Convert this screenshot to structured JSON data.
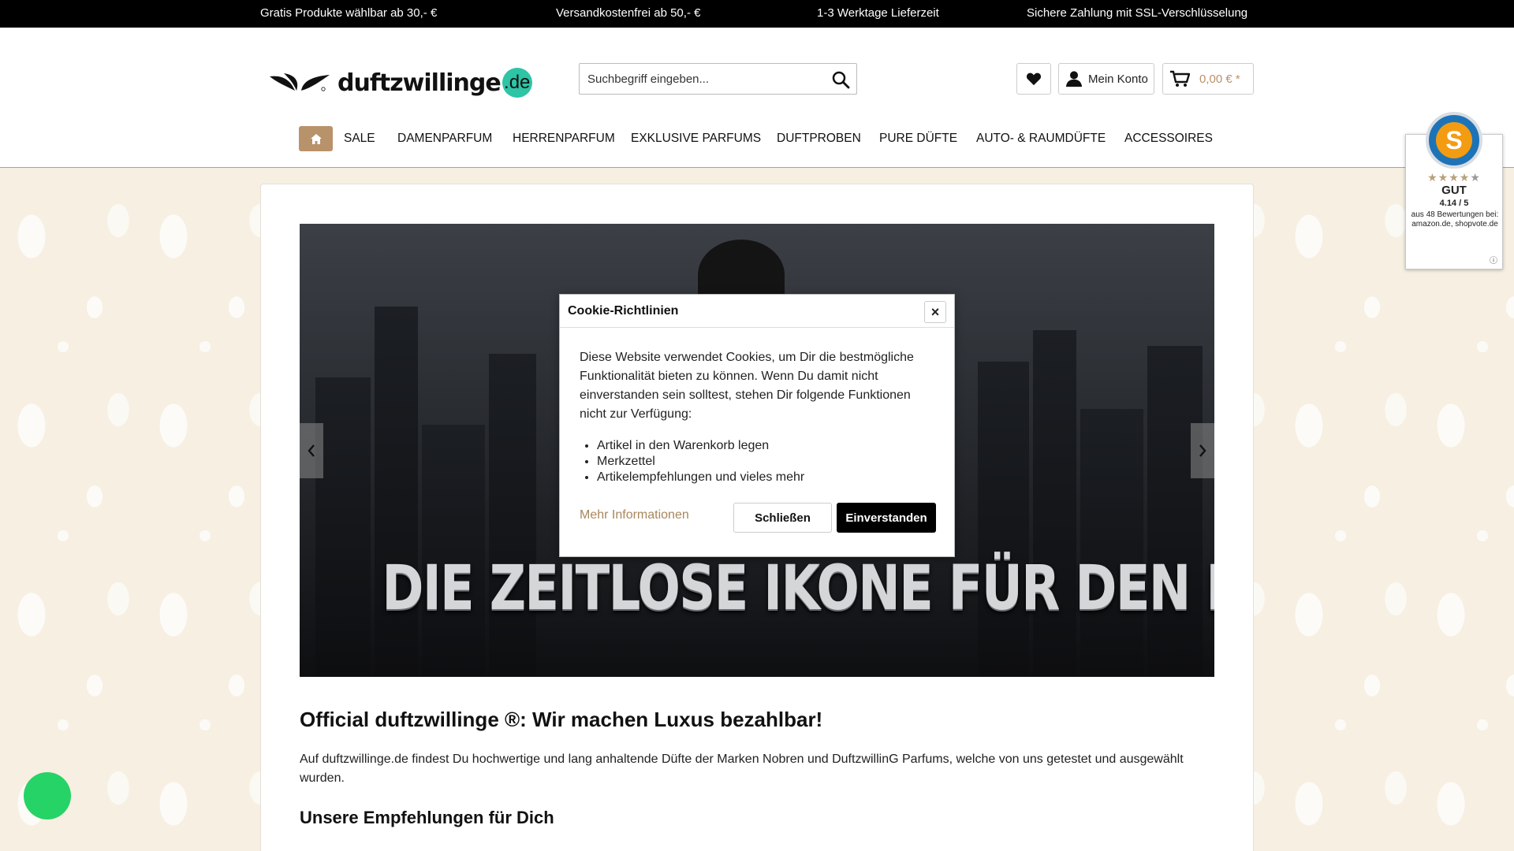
{
  "topbar": {
    "item1": "Gratis Produkte wählbar ab 30,- €",
    "item2": "Versandkostenfrei ab 50,- €",
    "item3": "1-3 Werktage Lieferzeit",
    "item4": "Sichere Zahlung mit SSL-Verschlüsselung"
  },
  "logo": {
    "text": "duftzwillinge",
    "tld": ".de"
  },
  "search": {
    "placeholder": "Suchbegriff eingeben..."
  },
  "header": {
    "account_label": "Mein Konto",
    "cart_label": "0,00 € *"
  },
  "nav": {
    "items": [
      "SALE",
      "DAMENPARFUM",
      "HERRENPARFUM",
      "EXKLUSIVE PARFUMS",
      "DUFTPROBEN",
      "PURE DÜFTE",
      "AUTO- & RAUMDÜFTE",
      "ACCESSOIRES"
    ]
  },
  "hero": {
    "text": "DIE ZEITLOSE IKONE FÜR DEN MANN."
  },
  "main": {
    "title": "Official duftzwillinge ®: Wir machen Luxus bezahlbar!",
    "intro": "Auf duftzwillinge.de findest Du hochwertige und lang anhaltende Düfte der Marken Nobren und DuftzwillinG Parfums, welche von uns getestet und ausgewählt wurden.",
    "subtitle": "Unsere Empfehlungen für Dich"
  },
  "cookie": {
    "title": "Cookie-Richtlinien",
    "close_symbol": "×",
    "text": "Diese Website verwendet Cookies, um Dir die bestmögliche Funktionalität bieten zu können. Wenn Du damit nicht einverstanden sein solltest, stehen Dir folgende Funktionen nicht zur Verfügung:",
    "items": [
      "Artikel in den Warenkorb legen",
      "Merkzettel",
      "Artikelempfehlungen und vieles mehr"
    ],
    "more_info": "Mehr Informationen",
    "close_button": "Schließen",
    "agree_button": "Einverstanden"
  },
  "shopvote": {
    "badge_letter": "S",
    "stars": "★★★★★",
    "grade": "GUT",
    "score": "4.14 / 5",
    "info": "aus 48 Bewertungen bei: amazon.de, shopvote.de",
    "info_icon": "ⓘ"
  },
  "colors": {
    "accent": "#b8926a",
    "topbar": "#000000",
    "chat": "#25d366"
  }
}
